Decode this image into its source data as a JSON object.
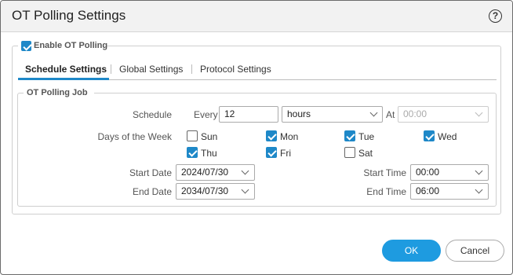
{
  "dialog": {
    "title": "OT Polling Settings",
    "help_icon_glyph": "?"
  },
  "enable": {
    "label": "Enable OT Polling",
    "checked": true
  },
  "tabs": [
    {
      "label": "Schedule Settings",
      "active": true
    },
    {
      "label": "Global Settings",
      "active": false
    },
    {
      "label": "Protocol Settings",
      "active": false
    }
  ],
  "job": {
    "legend": "OT Polling Job",
    "schedule": {
      "label": "Schedule",
      "every_label": "Every",
      "every_value": "12",
      "unit_value": "hours",
      "at_label": "At",
      "at_value": "00:00"
    },
    "days": {
      "label": "Days of the Week",
      "items": [
        {
          "label": "Sun",
          "checked": false
        },
        {
          "label": "Mon",
          "checked": true
        },
        {
          "label": "Tue",
          "checked": true
        },
        {
          "label": "Wed",
          "checked": true
        },
        {
          "label": "Thu",
          "checked": true
        },
        {
          "label": "Fri",
          "checked": true
        },
        {
          "label": "Sat",
          "checked": false
        }
      ]
    },
    "start_date": {
      "label": "Start Date",
      "value": "2024/07/30"
    },
    "end_date": {
      "label": "End Date",
      "value": "2034/07/30"
    },
    "start_time": {
      "label": "Start Time",
      "value": "00:00"
    },
    "end_time": {
      "label": "End Time",
      "value": "06:00"
    }
  },
  "buttons": {
    "ok": "OK",
    "cancel": "Cancel"
  },
  "colors": {
    "accent": "#1e88c8",
    "ok_button": "#1e9be0"
  }
}
